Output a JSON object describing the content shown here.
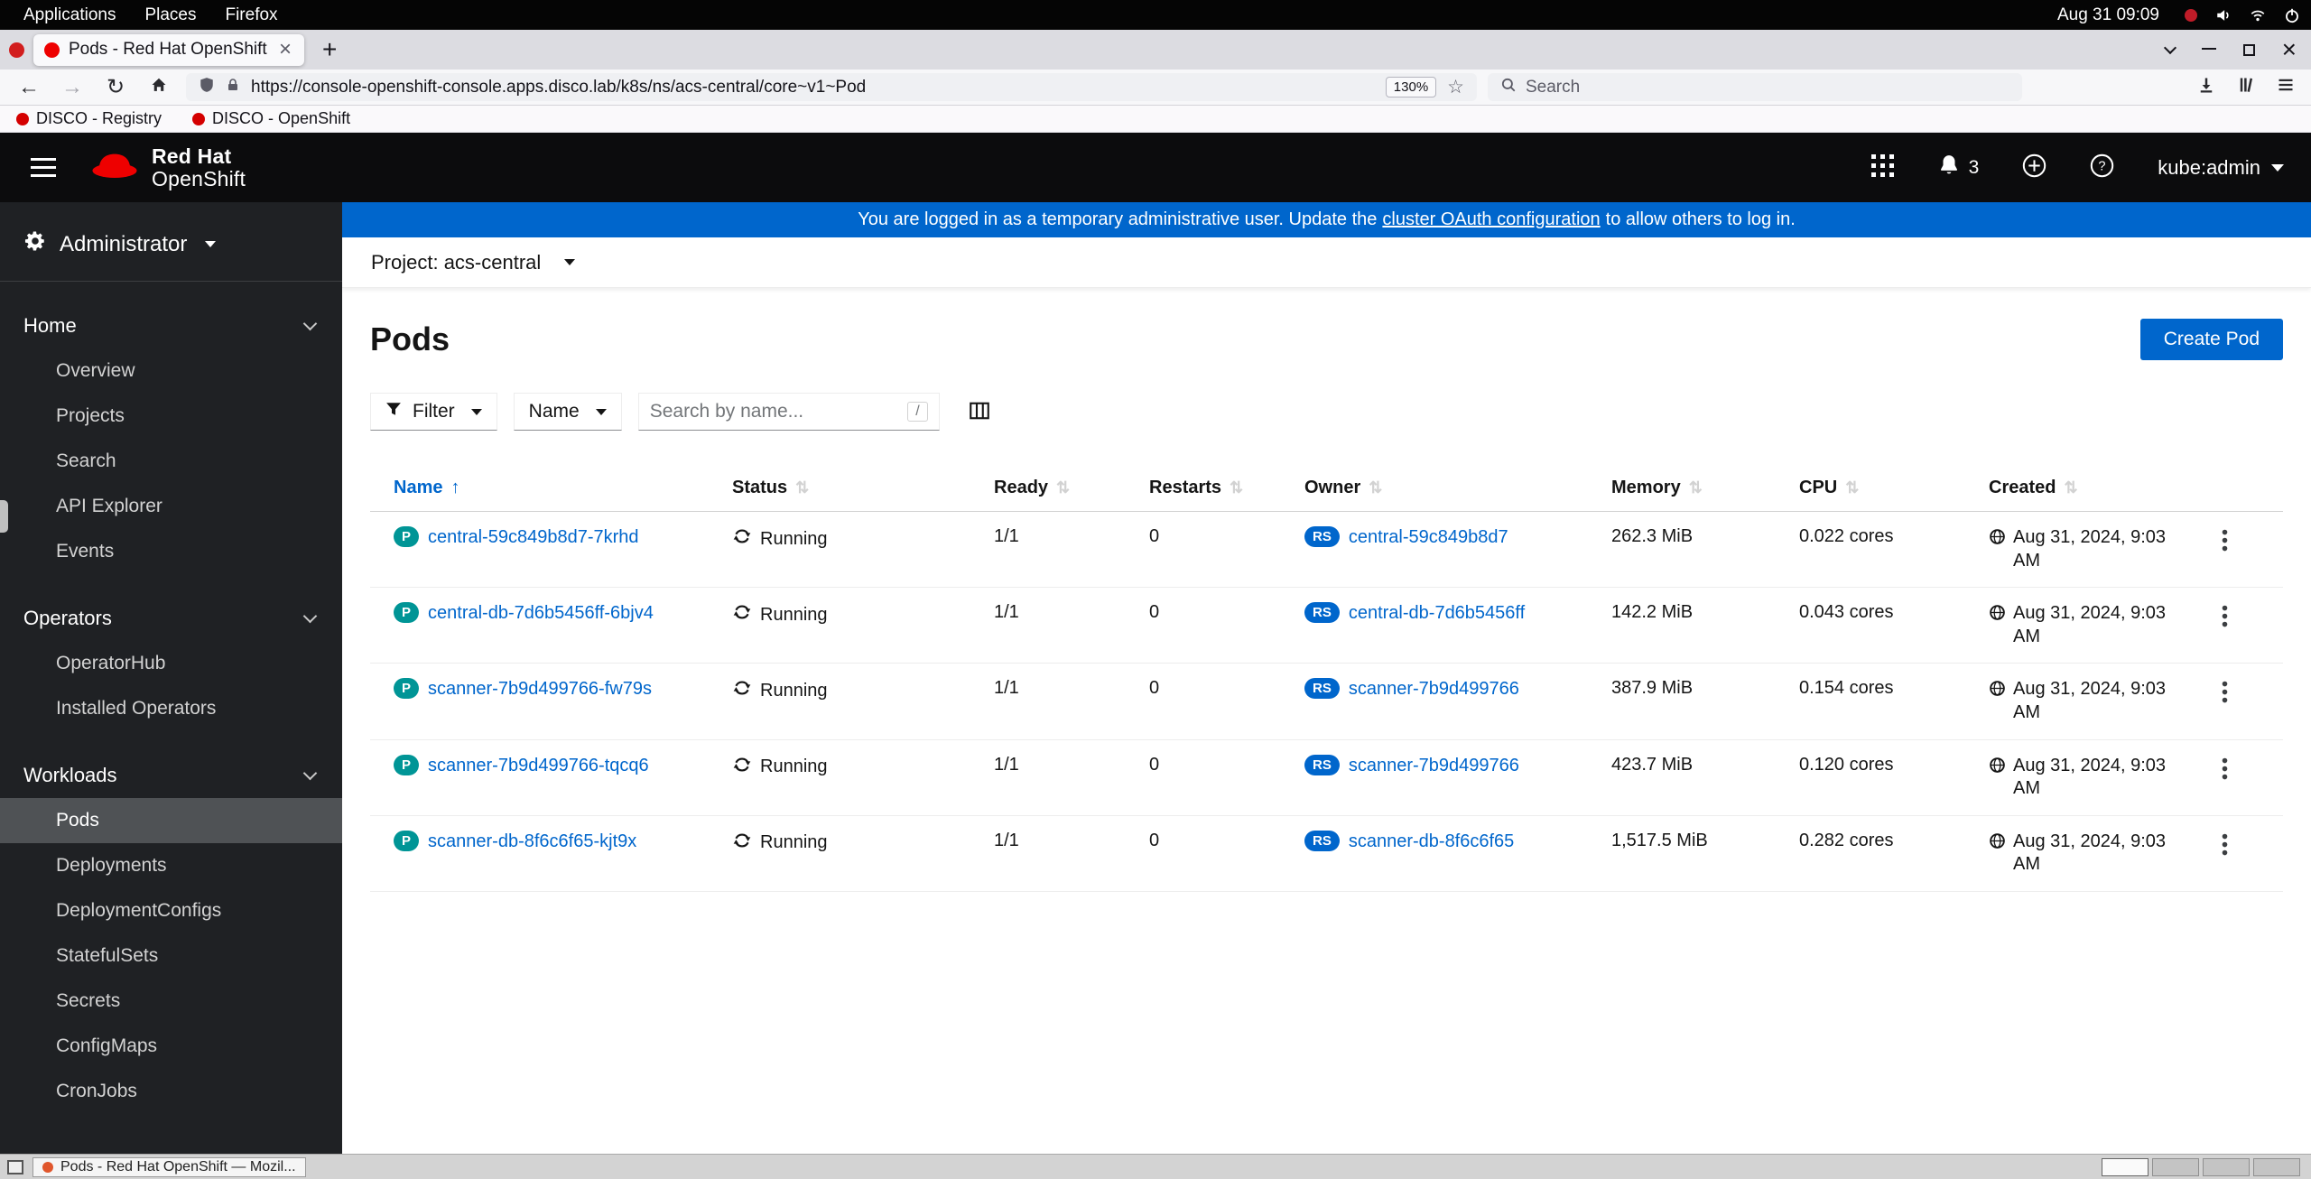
{
  "colors": {
    "accent": "#0066cc",
    "banner_bg": "#0066cc",
    "pod_badge_bg": "#009596",
    "replicaset_badge_bg": "#0066cc",
    "masthead_bg": "#0c0c0d",
    "sidebar_bg": "#1f2124",
    "sidebar_active_bg": "#4f5255",
    "brand_red": "#ee0000"
  },
  "desktop": {
    "topbar": {
      "menus": [
        "Applications",
        "Places",
        "Firefox"
      ],
      "clock": "Aug 31 09:09",
      "status_icons": [
        "record-icon",
        "volume-icon",
        "network-icon",
        "power-icon"
      ]
    },
    "taskbar": {
      "task_label": "Pods - Red Hat OpenShift — Mozil...",
      "workspace_count": 4
    }
  },
  "browser": {
    "tab_title": "Pods - Red Hat OpenShift",
    "url": "https://console-openshift-console.apps.disco.lab/k8s/ns/acs-central/core~v1~Pod",
    "zoom_level": "130%",
    "search_placeholder": "Search",
    "bookmarks": [
      "DISCO - Registry",
      "DISCO - OpenShift"
    ]
  },
  "console": {
    "masthead": {
      "brand_line1": "Red Hat",
      "brand_line2": "OpenShift",
      "notification_count": "3",
      "username": "kube:admin"
    },
    "banner": {
      "text_before": "You are logged in as a temporary administrative user. Update the",
      "link_text": "cluster OAuth configuration",
      "text_after": "to allow others to log in."
    },
    "sidebar": {
      "perspective": "Administrator",
      "sections": [
        {
          "label": "Home",
          "items": [
            "Overview",
            "Projects",
            "Search",
            "API Explorer",
            "Events"
          ]
        },
        {
          "label": "Operators",
          "items": [
            "OperatorHub",
            "Installed Operators"
          ]
        },
        {
          "label": "Workloads",
          "items": [
            "Pods",
            "Deployments",
            "DeploymentConfigs",
            "StatefulSets",
            "Secrets",
            "ConfigMaps",
            "CronJobs"
          ],
          "active": "Pods"
        }
      ]
    },
    "project_bar": {
      "label": "Project: acs-central"
    },
    "page": {
      "title": "Pods",
      "create_button_label": "Create Pod"
    },
    "toolbar": {
      "filter_label": "Filter",
      "attribute_label": "Name",
      "search_placeholder": "Search by name...",
      "shortcut_key": "/"
    },
    "table": {
      "columns": [
        "Name",
        "Status",
        "Ready",
        "Restarts",
        "Owner",
        "Memory",
        "CPU",
        "Created"
      ],
      "sorted_column": "Name",
      "sort_direction": "ascending",
      "name_badge": "P",
      "owner_badge": "RS",
      "rows": [
        {
          "name": "central-59c849b8d7-7krhd",
          "status": "Running",
          "ready": "1/1",
          "restarts": "0",
          "owner": "central-59c849b8d7",
          "memory": "262.3 MiB",
          "cpu": "0.022 cores",
          "created": "Aug 31, 2024, 9:03 AM"
        },
        {
          "name": "central-db-7d6b5456ff-6bjv4",
          "status": "Running",
          "ready": "1/1",
          "restarts": "0",
          "owner": "central-db-7d6b5456ff",
          "memory": "142.2 MiB",
          "cpu": "0.043 cores",
          "created": "Aug 31, 2024, 9:03 AM"
        },
        {
          "name": "scanner-7b9d499766-fw79s",
          "status": "Running",
          "ready": "1/1",
          "restarts": "0",
          "owner": "scanner-7b9d499766",
          "memory": "387.9 MiB",
          "cpu": "0.154 cores",
          "created": "Aug 31, 2024, 9:03 AM"
        },
        {
          "name": "scanner-7b9d499766-tqcq6",
          "status": "Running",
          "ready": "1/1",
          "restarts": "0",
          "owner": "scanner-7b9d499766",
          "memory": "423.7 MiB",
          "cpu": "0.120 cores",
          "created": "Aug 31, 2024, 9:03 AM"
        },
        {
          "name": "scanner-db-8f6c6f65-kjt9x",
          "status": "Running",
          "ready": "1/1",
          "restarts": "0",
          "owner": "scanner-db-8f6c6f65",
          "memory": "1,517.5 MiB",
          "cpu": "0.282 cores",
          "created": "Aug 31, 2024, 9:03 AM"
        }
      ]
    }
  }
}
